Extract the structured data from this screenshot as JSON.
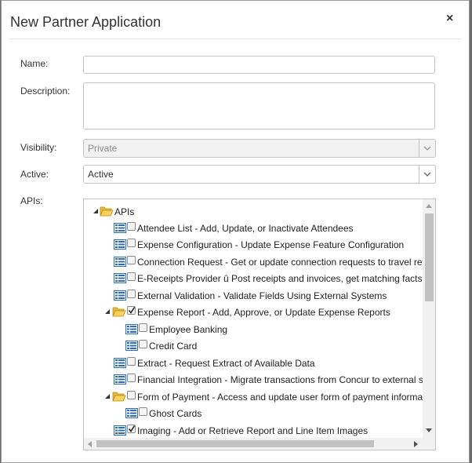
{
  "dialog": {
    "title": "New Partner Application",
    "close_label": "×"
  },
  "form": {
    "name_label": "Name:",
    "name_value": "",
    "description_label": "Description:",
    "description_value": "",
    "visibility_label": "Visibility:",
    "visibility_value": "Private",
    "active_label": "Active:",
    "active_value": "Active",
    "apis_label": "APIs:"
  },
  "tree": {
    "root": "APIs",
    "items": [
      {
        "label": "Attendee List - Add, Update, or Inactivate Attendees",
        "checked": false
      },
      {
        "label": "Expense Configuration - Update Expense Feature Configuration",
        "checked": false
      },
      {
        "label": "Connection Request - Get or update connection requests to travel reward",
        "checked": false
      },
      {
        "label": "E-Receipts Provider û Post receipts and invoices, get matching facts",
        "checked": false
      },
      {
        "label": "External Validation - Validate Fields Using External Systems",
        "checked": false
      },
      {
        "label": "Expense Report - Add, Approve, or Update Expense Reports",
        "checked": true,
        "expanded": true
      },
      {
        "label": "Employee Banking",
        "checked": false
      },
      {
        "label": "Credit Card",
        "checked": false
      },
      {
        "label": "Extract - Request Extract of Available Data",
        "checked": false
      },
      {
        "label": "Financial Integration - Migrate transactions from Concur to external syste",
        "checked": false
      },
      {
        "label": "Form of Payment - Access and update user form of payment information",
        "checked": false,
        "expanded": true
      },
      {
        "label": "Ghost Cards",
        "checked": false
      },
      {
        "label": "Imaging - Add or Retrieve Report and Line Item Images",
        "checked": true
      }
    ]
  },
  "colors": {
    "folder": "#f7d35c",
    "node_icon": "#2d6db5",
    "scroll_thumb": "#c1c1c1"
  }
}
